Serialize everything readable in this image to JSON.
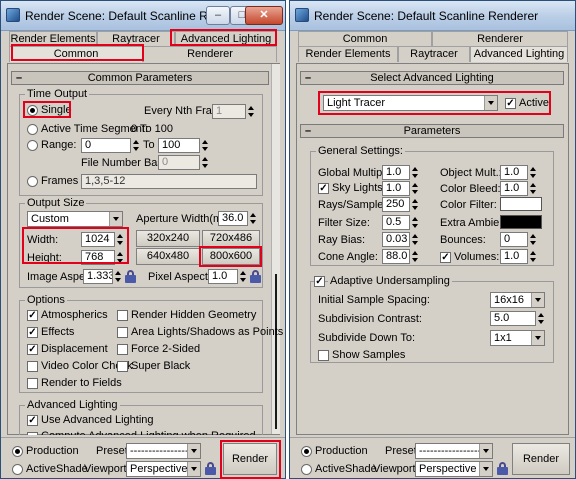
{
  "left": {
    "title": "Render Scene: Default Scanline Renderer",
    "tabs_row1": [
      "Render Elements",
      "Raytracer",
      "Advanced Lighting"
    ],
    "tabs_row2": [
      "Common",
      "Renderer"
    ],
    "rollout": "Common Parameters",
    "time_output": {
      "group": "Time Output",
      "single": "Single",
      "every_nth": "Every Nth Frame:",
      "every_nth_value": "1",
      "active_segment": "Active Time Segment:",
      "segment_range": "0 To 100",
      "range": "Range:",
      "range_from": "0",
      "range_to_label": "To",
      "range_to": "100",
      "file_number_base": "File Number Base:",
      "file_number_value": "0",
      "frames": "Frames",
      "frames_value": "1,3,5-12"
    },
    "output_size": {
      "group": "Output Size",
      "preset": "Custom",
      "aperture_label": "Aperture Width(mm):",
      "aperture_value": "36.0",
      "width_label": "Width:",
      "width_value": "1024",
      "height_label": "Height:",
      "height_value": "768",
      "presets": [
        "320x240",
        "720x486",
        "640x480",
        "800x600"
      ],
      "image_aspect_label": "Image Aspect:",
      "image_aspect_value": "1.333",
      "pixel_aspect_label": "Pixel Aspect:",
      "pixel_aspect_value": "1.0"
    },
    "options": {
      "group": "Options",
      "atmospherics": "Atmospherics",
      "effects": "Effects",
      "displacement": "Displacement",
      "video_color_check": "Video Color Check",
      "render_to_fields": "Render to Fields",
      "render_hidden": "Render Hidden Geometry",
      "area_lights": "Area Lights/Shadows as Points",
      "force_2sided": "Force 2-Sided",
      "super_black": "Super Black"
    },
    "adv_lighting": {
      "group": "Advanced Lighting",
      "use": "Use Advanced Lighting",
      "compute": "Compute Advanced Lighting when Required"
    },
    "bottom": {
      "production": "Production",
      "activeshade": "ActiveShade",
      "preset_label": "Preset:",
      "preset_value": "----------------------",
      "viewport_label": "Viewport:",
      "viewport_value": "Perspective",
      "render": "Render"
    }
  },
  "right": {
    "title": "Render Scene: Default Scanline Renderer",
    "tabs_row1": [
      "Common",
      "Renderer"
    ],
    "tabs_row2": [
      "Render Elements",
      "Raytracer",
      "Advanced Lighting"
    ],
    "select_rollout": "Select Advanced Lighting",
    "plugin": "Light Tracer",
    "active": "Active",
    "params_rollout": "Parameters",
    "general": {
      "group": "General Settings:",
      "global_mult_label": "Global Multiplier:",
      "global_mult": "1.0",
      "sky_lights_label": "Sky Lights:",
      "sky_lights": "1.0",
      "rays_label": "Rays/Sample:",
      "rays": "250",
      "filter_label": "Filter Size:",
      "filter": "0.5",
      "ray_bias_label": "Ray Bias:",
      "ray_bias": "0.03",
      "cone_label": "Cone Angle:",
      "cone": "88.0",
      "object_mult_label": "Object Mult.:",
      "object_mult": "1.0",
      "color_bleed_label": "Color Bleed:",
      "color_bleed": "1.0",
      "color_filter_label": "Color Filter:",
      "extra_ambient_label": "Extra Ambient:",
      "bounces_label": "Bounces:",
      "bounces": "0",
      "volumes_label": "Volumes:",
      "volumes": "1.0"
    },
    "adaptive": {
      "label": "Adaptive Undersampling",
      "initial_label": "Initial Sample Spacing:",
      "initial": "16x16",
      "contrast_label": "Subdivision Contrast:",
      "contrast": "5.0",
      "subdivide_label": "Subdivide Down To:",
      "subdivide": "1x1",
      "show_samples": "Show Samples"
    },
    "bottom": {
      "production": "Production",
      "activeshade": "ActiveShade",
      "preset_label": "Preset:",
      "preset_value": "----------------------",
      "viewport_label": "Viewport:",
      "viewport_value": "Perspective",
      "render": "Render"
    }
  },
  "colors": {
    "highlight": "#e3001b",
    "panel": "#d4d0c8",
    "color_filter": "#ffffff",
    "extra_ambient": "#000000"
  }
}
